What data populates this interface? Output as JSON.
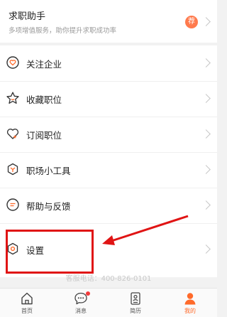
{
  "assistant": {
    "title": "求职助手",
    "subtitle": "多项增值服务，助你提升求职成功率",
    "badge": "荐"
  },
  "menu": [
    {
      "label": "关注企业",
      "icon": "heart-circle-icon"
    },
    {
      "label": "收藏职位",
      "icon": "star-icon"
    },
    {
      "label": "订阅职位",
      "icon": "heart-plus-icon"
    },
    {
      "label": "职场小工具",
      "icon": "toolbox-icon"
    },
    {
      "label": "帮助与反馈",
      "icon": "help-chat-icon"
    },
    {
      "label": "设置",
      "icon": "settings-icon"
    }
  ],
  "hotline": "客服电话：400-826-0101",
  "tabbar": [
    {
      "label": "首页",
      "icon": "home-icon",
      "active": false
    },
    {
      "label": "消息",
      "icon": "message-icon",
      "active": false,
      "has_dot": true
    },
    {
      "label": "简历",
      "icon": "resume-icon",
      "active": false
    },
    {
      "label": "我的",
      "icon": "profile-icon",
      "active": true
    }
  ],
  "colors": {
    "accent": "#ff6a2a",
    "badge": "#ff7a4d",
    "annotation": "#e01414",
    "notification_dot": "#f23b3b"
  }
}
